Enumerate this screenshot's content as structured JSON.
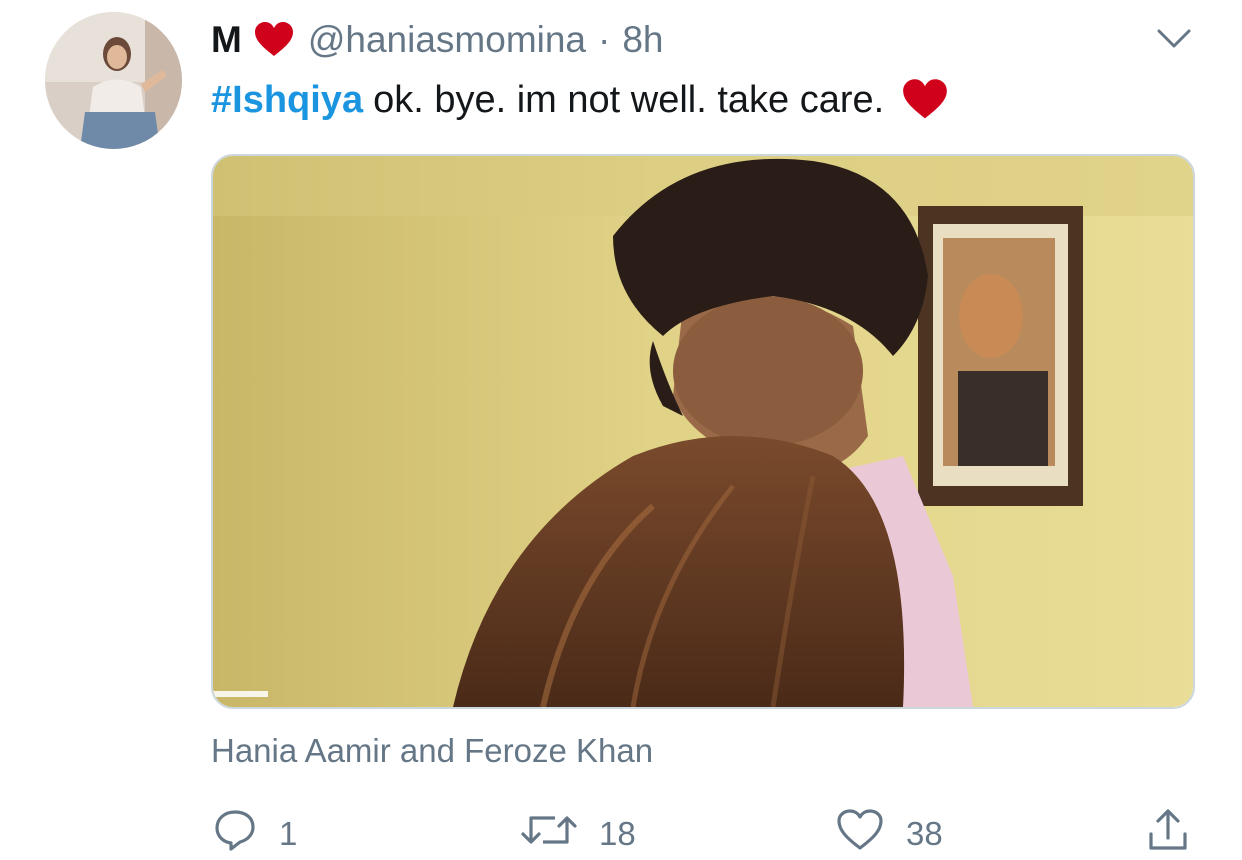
{
  "tweet": {
    "display_name": "M",
    "name_emoji": "heart-emoji",
    "handle": "@haniasmomina",
    "separator": "·",
    "time": "8h",
    "hashtag": "#Ishqiya",
    "text": "ok. bye. im not well. take care.",
    "text_emoji": "heart-emoji",
    "media_caption": "Hania Aamir and Feroze Khan"
  },
  "actions": {
    "reply_count": "1",
    "retweet_count": "18",
    "like_count": "38"
  },
  "colors": {
    "link": "#1b95e0",
    "secondary_text": "#657786",
    "heart": "#d0021b",
    "border": "#ccd6dd"
  },
  "icons": {
    "menu": "chevron-down-icon",
    "reply": "reply-icon",
    "retweet": "retweet-icon",
    "like": "heart-icon",
    "share": "share-icon"
  }
}
